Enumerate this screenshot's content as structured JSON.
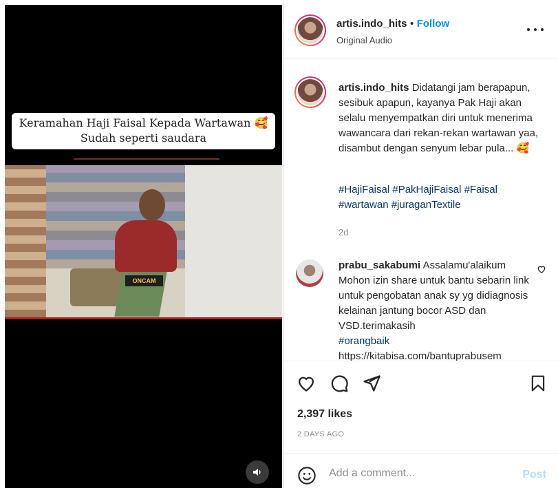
{
  "video": {
    "caption_line1": "Keramahan Haji Faisal Kepada Wartawan 🥰",
    "caption_line2": "Sudah seperti saudara",
    "badge": "ONCAM",
    "audio_icon": "speaker-icon"
  },
  "header": {
    "username": "artis.indo_hits",
    "separator": "•",
    "follow_label": "Follow",
    "subtitle": "Original Audio",
    "more_icon": "more-horizontal-icon"
  },
  "post": {
    "username": "artis.indo_hits",
    "text": "Didatangi jam berapapun, sesibuk apapun, kayanya Pak Haji akan selalu menyempatkan diri untuk menerima wawancara dari rekan-rekan wartawan yaa, disambut dengan senyum lebar pula... 🥰",
    "hashtags_line1": "#HajiFaisal #PakHajiFaisal #Faisal",
    "hashtags_line2": "#wartawan #juraganTextile",
    "time": "2d"
  },
  "comment": {
    "username": "prabu_sakabumi",
    "text": "Assalamu'alaikum Mohon izin share untuk bantu sebarin link untuk pengobatan anak sy yg didiagnosis kelainan jantung bocor ASD dan VSD.terimakasih",
    "tag": "#orangbaik",
    "link": "https://kitabisa.com/bantuprabusem"
  },
  "actions": {
    "likes": "2,397 likes",
    "date": "2 DAYS AGO"
  },
  "add_comment": {
    "placeholder": "Add a comment...",
    "post_label": "Post"
  },
  "colors": {
    "accent": "#0095f6",
    "hashtag": "#00376b",
    "muted": "#8e8e8e"
  }
}
